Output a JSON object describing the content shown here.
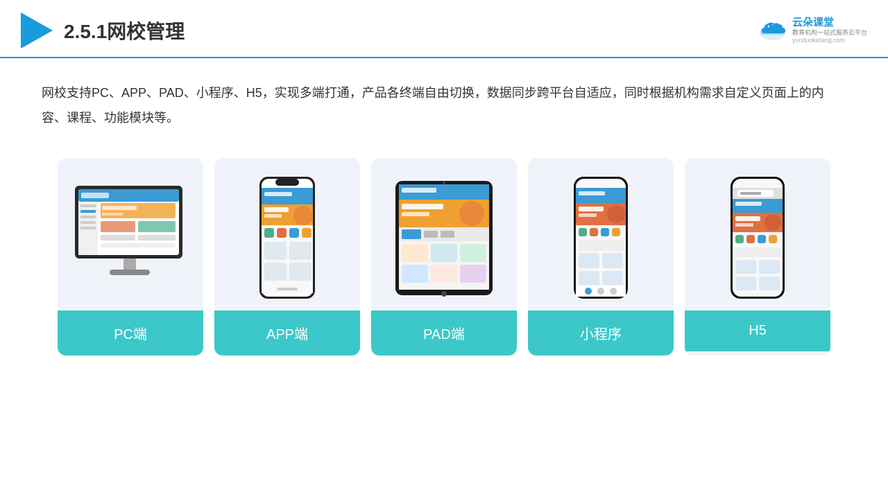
{
  "header": {
    "title": "2.5.1网校管理",
    "brand": {
      "name": "云朵课堂",
      "sub": "教育机构一站\n式服务云平台",
      "url": "yunduoketang.com"
    }
  },
  "description": {
    "text": "网校支持PC、APP、PAD、小程序、H5，实现多端打通，产品各终端自由切换，数据同步跨平台自适应，同时根据机构需求自定义页面上的内容、课程、功能模块等。"
  },
  "cards": [
    {
      "id": "pc",
      "label": "PC端"
    },
    {
      "id": "app",
      "label": "APP端"
    },
    {
      "id": "pad",
      "label": "PAD端"
    },
    {
      "id": "miniprogram",
      "label": "小程序"
    },
    {
      "id": "h5",
      "label": "H5"
    }
  ],
  "colors": {
    "accent": "#1a9bdc",
    "teal": "#3cc8c8",
    "card_bg": "#f0f4fa"
  }
}
